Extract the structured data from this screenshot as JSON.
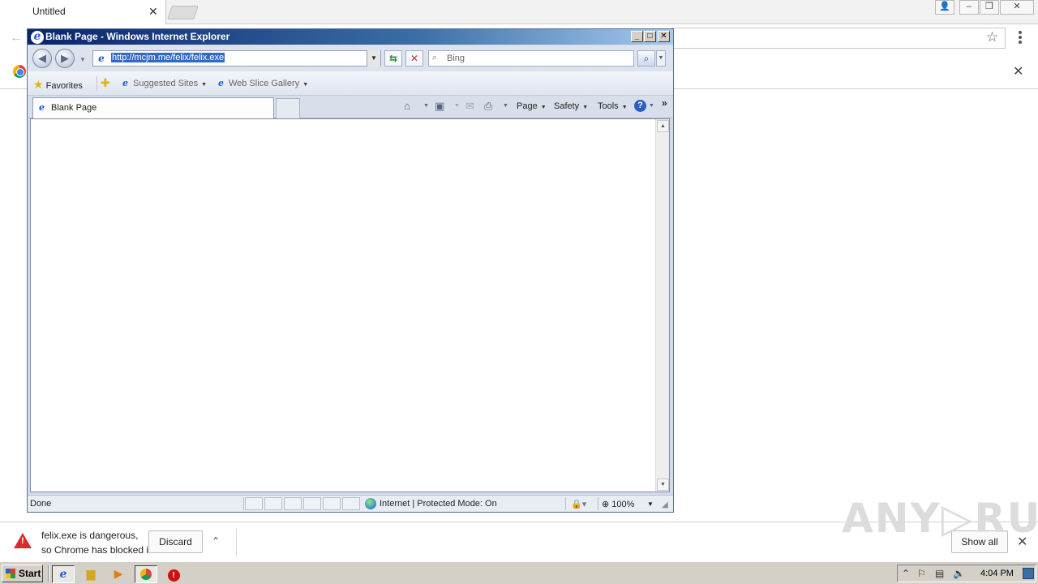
{
  "chrome": {
    "tab_title": "Untitled",
    "tab_close": "✕",
    "back_icon": "←",
    "star_icon": "☆",
    "infobar_close": "✕"
  },
  "ie": {
    "window_title": "Blank Page - Windows Internet Explorer",
    "controls": {
      "minimize": "_",
      "maximize": "□",
      "close": "✕"
    },
    "address": "http://mcjm.me/felix/felix.exe",
    "search_placeholder": "Bing",
    "favorites": {
      "label": "Favorites",
      "suggested": "Suggested Sites",
      "webslice": "Web Slice Gallery"
    },
    "tab_label": "Blank Page",
    "commands": {
      "page": "Page",
      "safety": "Safety",
      "tools": "Tools",
      "help": "?"
    },
    "status": {
      "left": "Done",
      "zone": "Internet | Protected Mode: On",
      "zoom": "100%"
    }
  },
  "download": {
    "line1": "felix.exe is dangerous,",
    "line2": "so Chrome has blocked it.",
    "discard": "Discard",
    "show_all": "Show all"
  },
  "watermark": "ANY RUN",
  "taskbar": {
    "start": "Start",
    "clock": "4:04 PM"
  },
  "colors": {
    "ie_title_gradient_start": "#0a246a",
    "warning_red": "#d32f2f",
    "taskbar": "#d4d0c8"
  }
}
